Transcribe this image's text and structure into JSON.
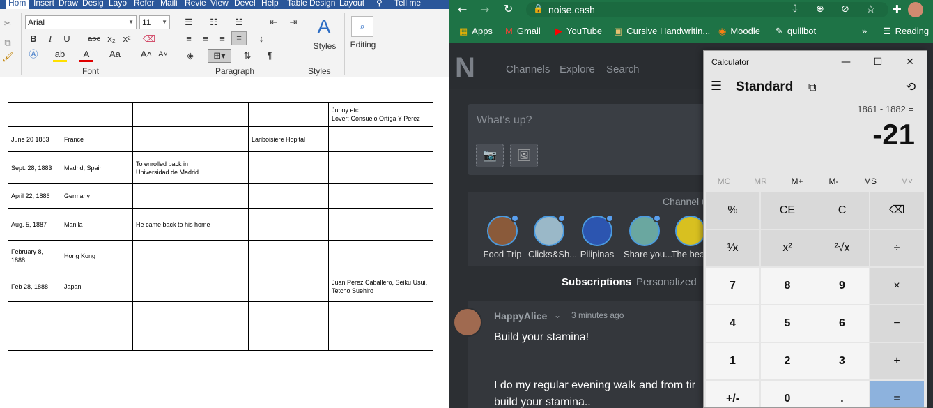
{
  "word": {
    "tabs": [
      "Hom",
      "Insert",
      "Draw",
      "Desig",
      "Layo",
      "Refer",
      "Maili",
      "Revie",
      "View",
      "Devel",
      "Help",
      "Table Design",
      "Layout",
      "Tell me"
    ],
    "font_name": "Arial",
    "font_size": "11",
    "groups": {
      "font": "Font",
      "paragraph": "Paragraph",
      "styles": "Styles"
    },
    "styles_label": "Styles",
    "editing_label": "Editing",
    "table": [
      [
        "",
        "",
        "",
        "",
        "",
        "Junoy etc.\nLover: Consuelo Ortiga Y Perez"
      ],
      [
        "June 20 1883",
        "France",
        "",
        "",
        "Lariboisiere Hopital",
        ""
      ],
      [
        "Sept. 28, 1883",
        "Madrid, Spain",
        "To enrolled back in Universidad de Madrid",
        "",
        "",
        ""
      ],
      [
        "April 22, 1886",
        "Germany",
        "",
        "",
        "",
        ""
      ],
      [
        "Aug. 5, 1887",
        "Manila",
        "He came back to his home",
        "",
        "",
        ""
      ],
      [
        "February 8, 1888",
        "Hong Kong",
        "",
        "",
        "",
        ""
      ],
      [
        "Feb 28, 1888",
        "Japan",
        "",
        "",
        "",
        "Juan Perez Caballero, Seiku Usui, Tetcho Suehiro"
      ],
      [
        "",
        "",
        "",
        "",
        "",
        ""
      ],
      [
        "",
        "",
        "",
        "",
        "",
        ""
      ]
    ]
  },
  "browser": {
    "url": "noise.cash",
    "bookmarks": [
      "Apps",
      "Gmail",
      "YouTube",
      "Cursive Handwritin...",
      "Moodle",
      "quillbot",
      "Reading"
    ],
    "nav": [
      "Channels",
      "Explore",
      "Search"
    ],
    "post_placeholder": "What's up?",
    "channel_heading": "Channel u",
    "channels": [
      "Food Trip",
      "Clicks&Sh...",
      "Pilipinas",
      "Share you...",
      "The beau"
    ],
    "feed_tabs": [
      "Subscriptions",
      "Personalized"
    ],
    "post": {
      "author": "HappyAlice",
      "time": "3 minutes ago",
      "title": "Build your stamina!",
      "body1": "I do my regular evening walk and from tir",
      "body2": "build your stamina.."
    }
  },
  "calculator": {
    "title": "Calculator",
    "mode": "Standard",
    "expression": "1861 - 1882 =",
    "result": "-21",
    "memory": [
      "MC",
      "MR",
      "M+",
      "M-",
      "MS",
      "M˅"
    ],
    "keys": [
      [
        "%",
        "CE",
        "C",
        "⌫"
      ],
      [
        "¹⁄x",
        "x²",
        "²√x",
        "÷"
      ],
      [
        "7",
        "8",
        "9",
        "×"
      ],
      [
        "4",
        "5",
        "6",
        "−"
      ],
      [
        "1",
        "2",
        "3",
        "+"
      ],
      [
        "+/-",
        "0",
        ".",
        "="
      ]
    ]
  },
  "colors": {
    "word_blue": "#2b579a",
    "chrome_green": "#1e7346",
    "equals": "#8db2dd"
  }
}
